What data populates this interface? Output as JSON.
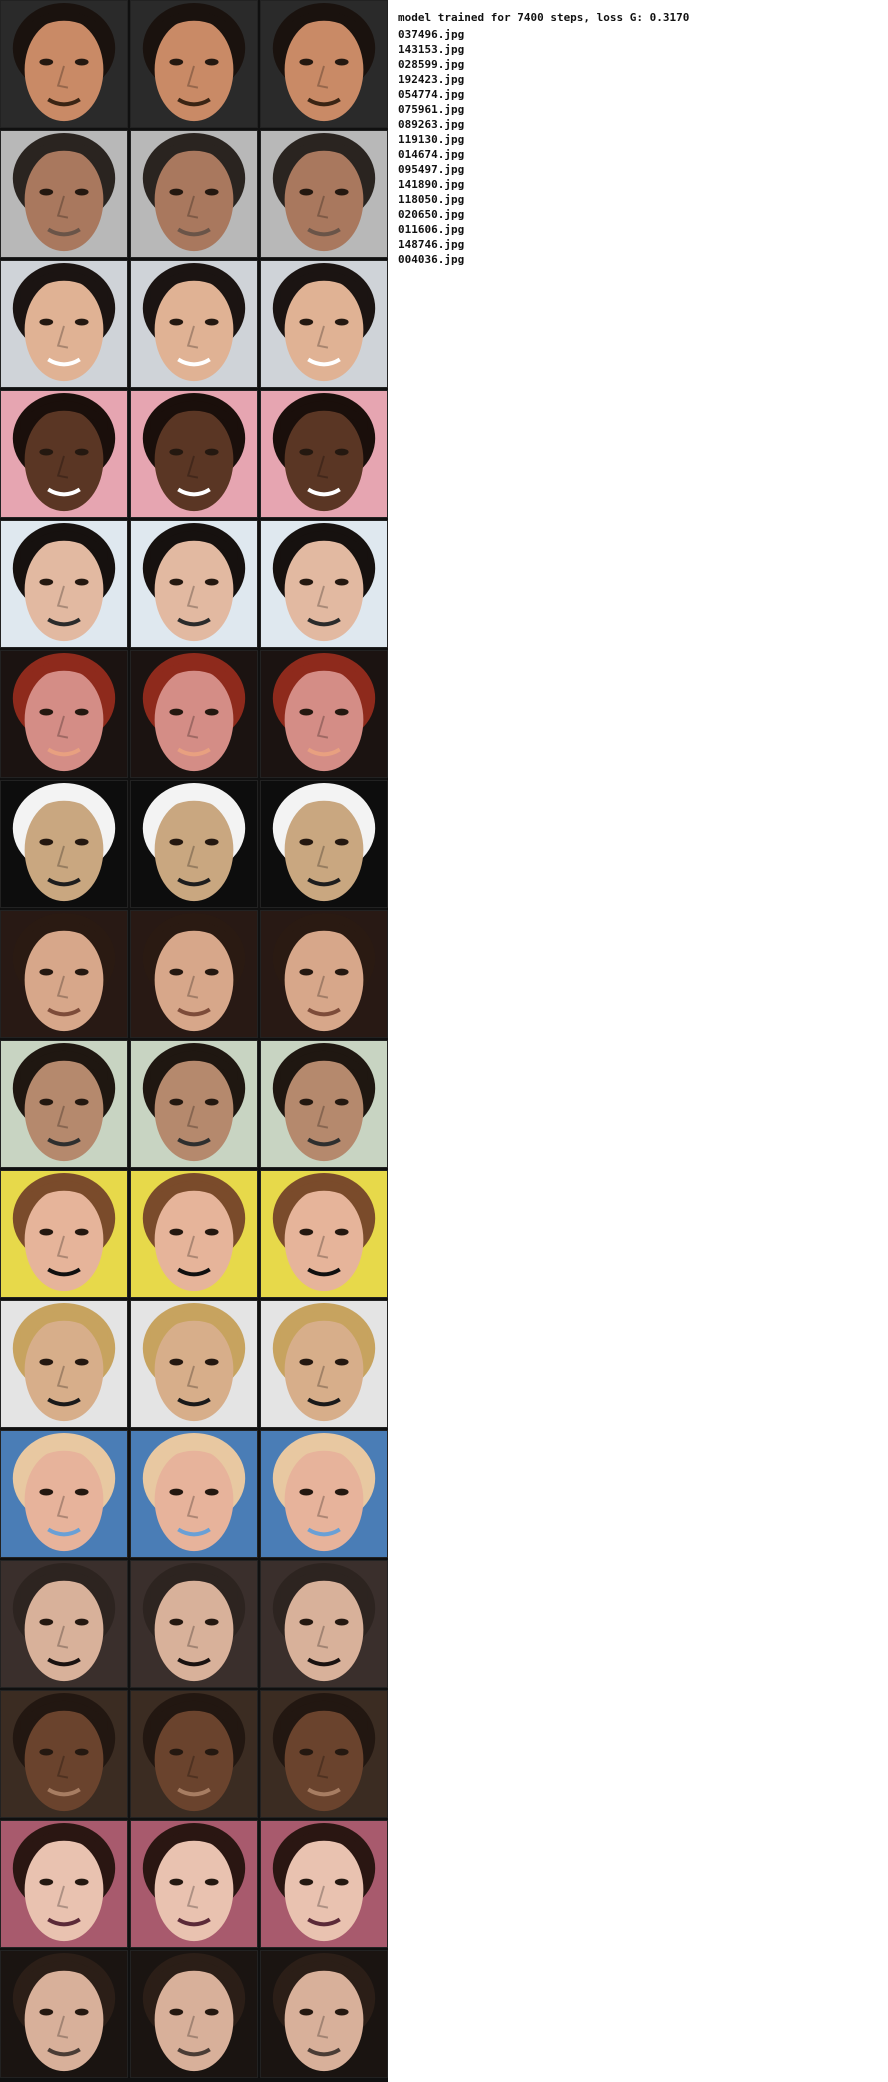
{
  "summary_line": "model trained for 7400 steps, loss G: 0.3170",
  "files": [
    "037496.jpg",
    "143153.jpg",
    "028599.jpg",
    "192423.jpg",
    "054774.jpg",
    "075961.jpg",
    "089263.jpg",
    "119130.jpg",
    "014674.jpg",
    "095497.jpg",
    "141890.jpg",
    "118050.jpg",
    "020650.jpg",
    "011606.jpg",
    "148746.jpg",
    "004036.jpg"
  ],
  "rows": [
    {
      "bg": "#2a2a2a",
      "skin": "#c98a66",
      "hair": "#1a120e",
      "accent": "#3a2414"
    },
    {
      "bg": "#b8b8b8",
      "skin": "#a9785e",
      "hair": "#2a2420",
      "accent": "#6a5448"
    },
    {
      "bg": "#cfd3d8",
      "skin": "#e0b294",
      "hair": "#1b1412",
      "accent": "#ffffff"
    },
    {
      "bg": "#e6a5b1",
      "skin": "#5a3624",
      "hair": "#1a0f0b",
      "accent": "#ffffff"
    },
    {
      "bg": "#dfe8ef",
      "skin": "#e2b9a1",
      "hair": "#16110f",
      "accent": "#2b2b2b"
    },
    {
      "bg": "#1b1311",
      "skin": "#d48d86",
      "hair": "#8e2a1c",
      "accent": "#e8a080"
    },
    {
      "bg": "#0d0d0d",
      "skin": "#c9a780",
      "hair": "#f3f3f3",
      "accent": "#1e1e1e"
    },
    {
      "bg": "#281914",
      "skin": "#d7a78a",
      "hair": "#2a1a12",
      "accent": "#7d4c3a"
    },
    {
      "bg": "#c8d4c2",
      "skin": "#b5896d",
      "hair": "#1f1711",
      "accent": "#2f2f2f"
    },
    {
      "bg": "#e7d94a",
      "skin": "#e6b49a",
      "hair": "#7a4b2b",
      "accent": "#101010"
    },
    {
      "bg": "#e4e4e4",
      "skin": "#d7ae8a",
      "hair": "#c7a35f",
      "accent": "#1a1a1a"
    },
    {
      "bg": "#4a7db6",
      "skin": "#e7b39b",
      "hair": "#e8c8a1",
      "accent": "#6aa0d6"
    },
    {
      "bg": "#3a2f2c",
      "skin": "#d8b19a",
      "hair": "#2d2420",
      "accent": "#1a1210"
    },
    {
      "bg": "#3b2c22",
      "skin": "#6a432d",
      "hair": "#221711",
      "accent": "#a77d62"
    },
    {
      "bg": "#a85a6d",
      "skin": "#e9c2b0",
      "hair": "#2a1612",
      "accent": "#5b2a38"
    },
    {
      "bg": "#1a1411",
      "skin": "#d8b09a",
      "hair": "#2b1e17",
      "accent": "#4a3c35"
    }
  ]
}
